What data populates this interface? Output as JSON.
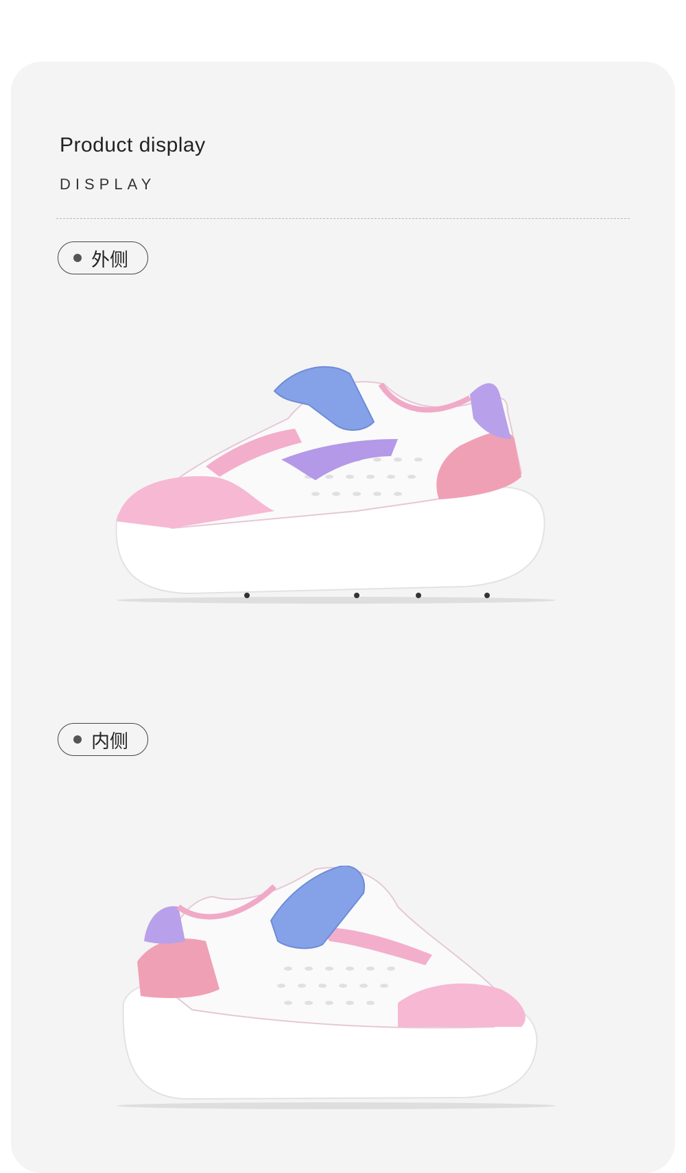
{
  "section": {
    "title": "Product display",
    "subtitle": "DISPLAY"
  },
  "views": [
    {
      "label": "外侧",
      "icon": "sneaker-lateral-view"
    },
    {
      "label": "内侧",
      "icon": "sneaker-medial-view"
    }
  ],
  "colors": {
    "card_bg": "#f4f4f4",
    "shoe_pink": "#f2a9c6",
    "shoe_blue": "#7f9fe6",
    "shoe_purple": "#b39be6",
    "sole_white": "#ffffff"
  }
}
